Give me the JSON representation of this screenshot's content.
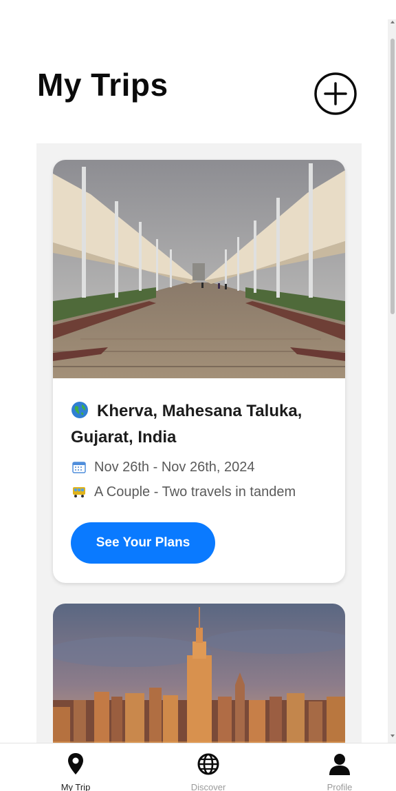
{
  "header": {
    "title": "My Trips",
    "add_icon": "plus-circle-icon"
  },
  "trips": [
    {
      "location": "Kherva, Mahesana Taluka, Gujarat, India",
      "location_icon": "globe-icon",
      "dates": "Nov 26th - Nov 26th, 2024",
      "dates_icon": "calendar-icon",
      "travelers": "A Couple - Two travels in tandem",
      "travelers_icon": "bus-icon",
      "button_label": "See Your Plans",
      "image": "canopy-walkway-photo"
    },
    {
      "image": "city-skyline-photo"
    }
  ],
  "tabbar": {
    "items": [
      {
        "label": "My Trip",
        "icon": "map-pin-icon",
        "active": true
      },
      {
        "label": "Discover",
        "icon": "globe-icon",
        "active": false
      },
      {
        "label": "Profile",
        "icon": "user-icon",
        "active": false
      }
    ]
  },
  "colors": {
    "accent": "#0a7aff",
    "panel": "#f2f2f2",
    "text_primary": "#0b0b0b",
    "text_secondary": "#5a5a5a"
  }
}
